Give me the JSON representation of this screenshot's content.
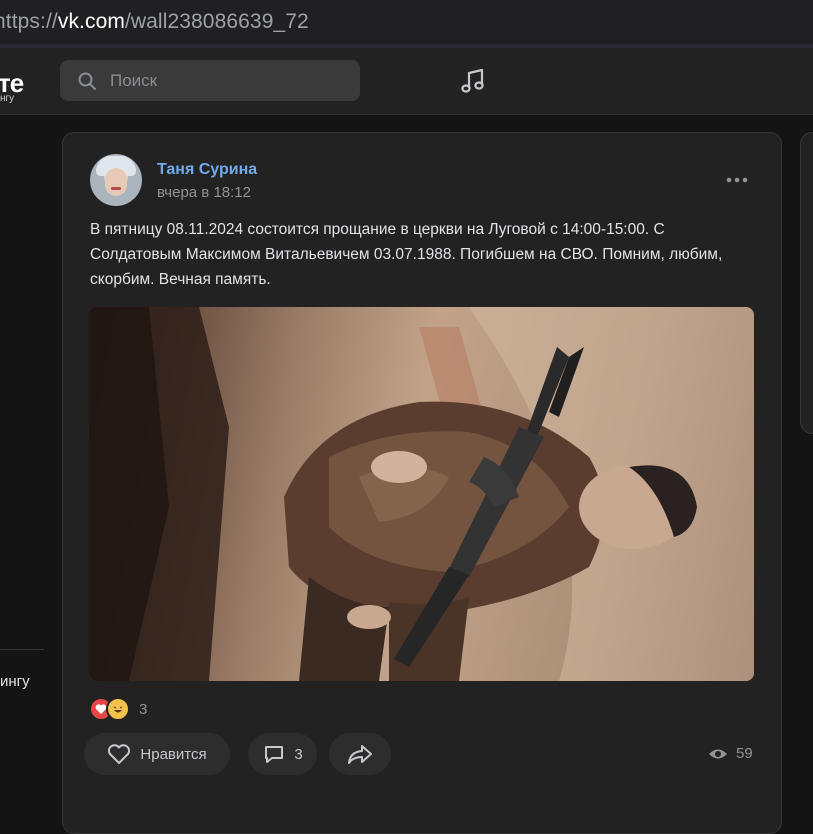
{
  "browser": {
    "url_scheme": "https://",
    "url_host": "vk.com",
    "url_path": "/wall238086639_72"
  },
  "header": {
    "logo_text": "те",
    "logo_sub": "нгу",
    "search_placeholder": "Поиск",
    "music_icon": "music-note-icon"
  },
  "sidebar": {
    "partial_label": "ингу"
  },
  "post": {
    "author": "Таня Сурина",
    "time": "вчера в 18:12",
    "text": "В пятницу 08.11.2024 состоится прощание в церкви на Луговой с 14:00-15:00. С Солдатовым Максимом Витальевичем 03.07.1988. Погибшем на СВО. Помним, любим, скорбим. Вечная память.",
    "reactions_count": "3",
    "like_label": "Нравится",
    "comments_count": "3",
    "views_count": "59"
  },
  "colors": {
    "link": "#71aaeb",
    "background": "#141414",
    "card": "#222222"
  }
}
